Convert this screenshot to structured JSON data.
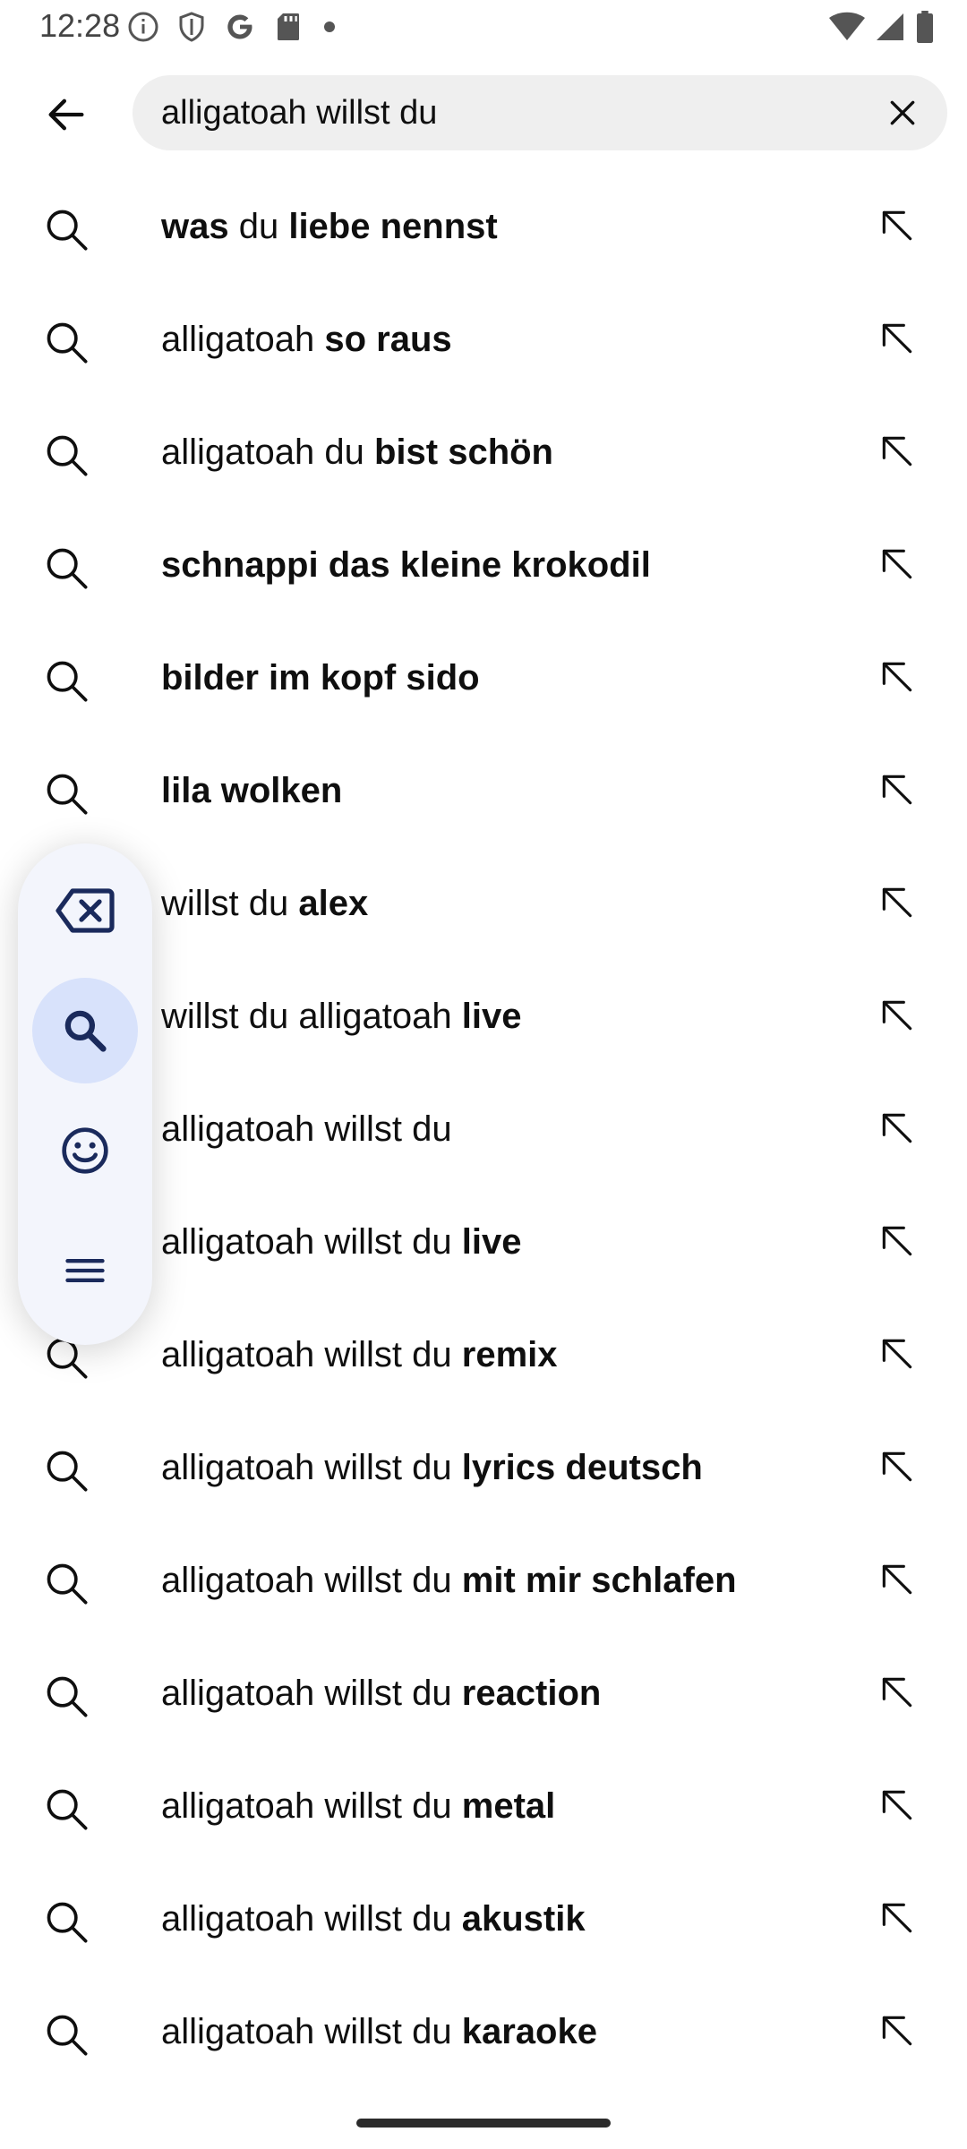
{
  "status_bar": {
    "time": "12:28",
    "left_icons": [
      "info-icon",
      "shield-icon",
      "google-icon",
      "sd-card-icon",
      "dot-icon"
    ],
    "right_icons": [
      "wifi-icon",
      "signal-icon",
      "battery-icon"
    ]
  },
  "search": {
    "query": "alligatoah willst du",
    "back_icon": "arrow-left-icon",
    "clear_icon": "close-icon"
  },
  "suggestions": [
    {
      "parts": [
        {
          "t": "was",
          "b": true
        },
        {
          "t": " du ",
          "b": false
        },
        {
          "t": "liebe nennst",
          "b": true
        }
      ]
    },
    {
      "parts": [
        {
          "t": "alligatoah ",
          "b": false
        },
        {
          "t": "so raus",
          "b": true
        }
      ]
    },
    {
      "parts": [
        {
          "t": "alligatoah du ",
          "b": false
        },
        {
          "t": "bist schön",
          "b": true
        }
      ]
    },
    {
      "parts": [
        {
          "t": "schnappi das kleine krokodil",
          "b": true
        }
      ]
    },
    {
      "parts": [
        {
          "t": "bilder im kopf sido",
          "b": true
        }
      ]
    },
    {
      "parts": [
        {
          "t": "lila wolken",
          "b": true
        }
      ]
    },
    {
      "parts": [
        {
          "t": "willst du ",
          "b": false
        },
        {
          "t": "alex",
          "b": true
        }
      ]
    },
    {
      "parts": [
        {
          "t": "willst du alligatoah ",
          "b": false
        },
        {
          "t": "live",
          "b": true
        }
      ]
    },
    {
      "parts": [
        {
          "t": "alligatoah willst du",
          "b": false
        }
      ]
    },
    {
      "parts": [
        {
          "t": "alligatoah willst du ",
          "b": false
        },
        {
          "t": "live",
          "b": true
        }
      ]
    },
    {
      "parts": [
        {
          "t": "alligatoah willst du ",
          "b": false
        },
        {
          "t": "remix",
          "b": true
        }
      ]
    },
    {
      "parts": [
        {
          "t": "alligatoah willst du ",
          "b": false
        },
        {
          "t": "lyrics deutsch",
          "b": true
        }
      ]
    },
    {
      "parts": [
        {
          "t": "alligatoah willst du ",
          "b": false
        },
        {
          "t": "mit mir schlafen",
          "b": true
        }
      ]
    },
    {
      "parts": [
        {
          "t": "alligatoah willst du ",
          "b": false
        },
        {
          "t": "reaction",
          "b": true
        }
      ]
    },
    {
      "parts": [
        {
          "t": "alligatoah willst du ",
          "b": false
        },
        {
          "t": "metal",
          "b": true
        }
      ]
    },
    {
      "parts": [
        {
          "t": "alligatoah willst du ",
          "b": false
        },
        {
          "t": "akustik",
          "b": true
        }
      ]
    },
    {
      "parts": [
        {
          "t": "alligatoah willst du ",
          "b": false
        },
        {
          "t": "karaoke",
          "b": true
        }
      ]
    }
  ],
  "keyboard_toolbar": {
    "buttons": [
      {
        "icon": "backspace-icon",
        "active": false
      },
      {
        "icon": "search-icon",
        "active": true
      },
      {
        "icon": "emoji-icon",
        "active": false
      },
      {
        "icon": "menu-icon",
        "active": false
      }
    ],
    "accent_color": "#d8e2fb",
    "icon_color": "#1a2a5c"
  }
}
